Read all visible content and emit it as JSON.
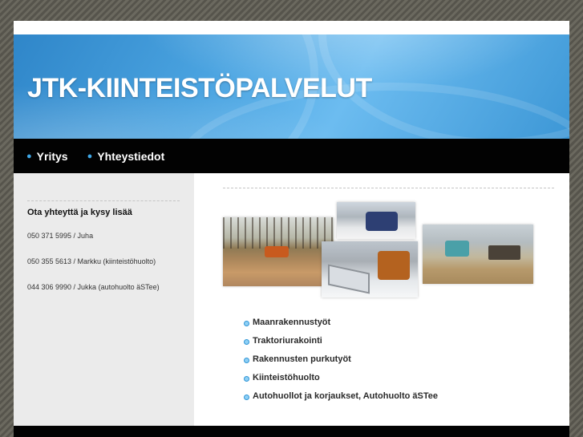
{
  "header": {
    "title": "JTK-KIINTEISTÖPALVELUT"
  },
  "nav": {
    "items": [
      {
        "label": "Yritys"
      },
      {
        "label": "Yhteystiedot"
      }
    ]
  },
  "sidebar": {
    "heading": "Ota yhteyttä ja kysy lisää",
    "contacts": [
      "050 371 5995 / Juha",
      "050 355 5613 / Markku (kiinteistöhuolto)",
      "044 306 9990 / Jukka (autohuolto äSTee)"
    ]
  },
  "main": {
    "services": [
      "Maanrakennustyöt",
      "Traktoriurakointi",
      "Rakennusten purkutyöt",
      "Kiinteistöhuolto",
      "Autohuollot ja korjaukset, Autohuolto äSTee"
    ]
  },
  "colors": {
    "accent": "#3fa7e6",
    "nav_bg": "#020202",
    "sidebar_bg": "#ebebeb",
    "header_blue": "#4aa3e0"
  }
}
